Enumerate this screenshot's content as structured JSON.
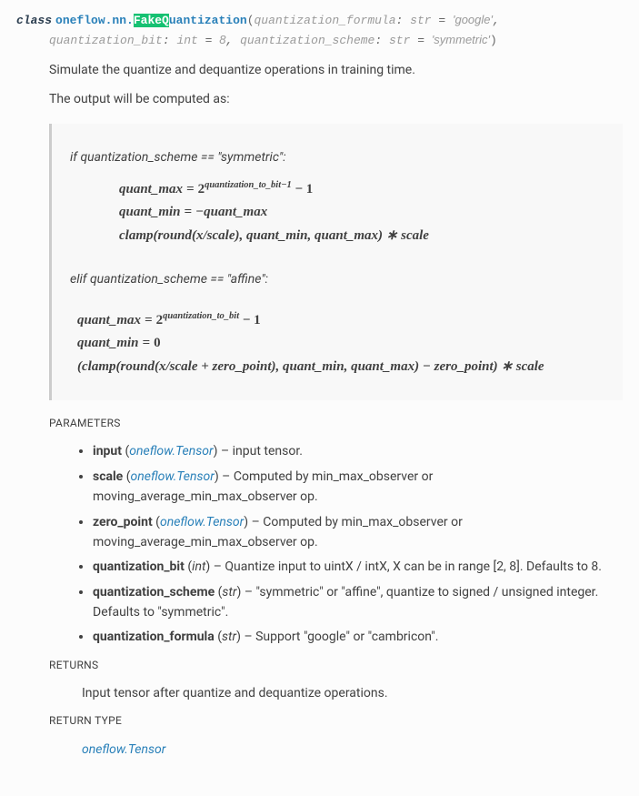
{
  "signature": {
    "property": "class",
    "prename": "oneflow.nn.",
    "name_hl": "FakeQ",
    "name_rest": "uantization",
    "open": "(",
    "close": ")",
    "args": [
      {
        "n": "quantization_formula",
        "ann": "str",
        "def": "'google'"
      },
      {
        "n": "quantization_bit",
        "ann": "int",
        "def": "8"
      },
      {
        "n": "quantization_scheme",
        "ann": "str",
        "def": "'symmetric'"
      }
    ]
  },
  "desc1": "Simulate the quantize and dequantize operations in training time.",
  "desc2": "The output will be computed as:",
  "case1": "if quantization_scheme == \"symmetric\":",
  "case2": "elif quantization_scheme == \"affine\":",
  "math1": {
    "l1a": "quant_max",
    "l1eq": "=",
    "l1b": "2",
    "l1exp": "quantization_to_bit−1",
    "l1c": " − 1",
    "l2a": "quant_min",
    "l2eq": "=",
    "l2b": "−quant_max",
    "l3": "clamp(round(x/scale), quant_min, quant_max) ∗ scale"
  },
  "math2": {
    "l1a": "quant_max",
    "l1eq": "=",
    "l1b": "2",
    "l1exp": "quantization_to_bit",
    "l1c": " − 1",
    "l2a": "quant_min",
    "l2eq": "=",
    "l2b": "0",
    "l3": "(clamp(round(x/scale + zero_point), quant_min, quant_max) − zero_point) ∗ scale"
  },
  "labels": {
    "params": "PARAMETERS",
    "returns": "RETURNS",
    "returntype": "RETURN TYPE"
  },
  "params": [
    {
      "name": "input",
      "type": "oneflow.Tensor",
      "linked": true,
      "desc": "input tensor."
    },
    {
      "name": "scale",
      "type": "oneflow.Tensor",
      "linked": true,
      "desc": "Computed by min_max_observer or moving_average_min_max_observer op."
    },
    {
      "name": "zero_point",
      "type": "oneflow.Tensor",
      "linked": true,
      "desc": "Computed by min_max_observer or moving_average_min_max_observer op."
    },
    {
      "name": "quantization_bit",
      "type": "int",
      "linked": false,
      "desc": "Quantize input to uintX / intX, X can be in range [2, 8]. Defaults to 8."
    },
    {
      "name": "quantization_scheme",
      "type": "str",
      "linked": false,
      "desc": "\"symmetric\" or \"affine\", quantize to signed / unsigned integer. Defaults to \"symmetric\"."
    },
    {
      "name": "quantization_formula",
      "type": "str",
      "linked": false,
      "desc": "Support \"google\" or \"cambricon\"."
    }
  ],
  "returns_text": "Input tensor after quantize and dequantize operations.",
  "return_type": "oneflow.Tensor"
}
